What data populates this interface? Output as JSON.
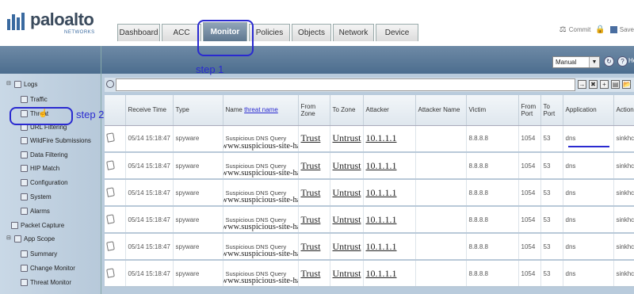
{
  "header": {
    "logo_text": "paloalto",
    "logo_sub": "NETWORKS",
    "tabs": [
      "Dashboard",
      "ACC",
      "Monitor",
      "Policies",
      "Objects",
      "Network",
      "Device"
    ],
    "commit_label": "Commit",
    "save_label": "Save"
  },
  "annotations": {
    "step1": "step 1",
    "step2": "step 2",
    "threat_name_note": "threat name"
  },
  "sidebar": {
    "items": [
      {
        "label": "Logs",
        "level": 0,
        "toggle": "⊟"
      },
      {
        "label": "Traffic",
        "level": 1
      },
      {
        "label": "Threat",
        "level": 1
      },
      {
        "label": "URL Filtering",
        "level": 1
      },
      {
        "label": "WildFire Submissions",
        "level": 1
      },
      {
        "label": "Data Filtering",
        "level": 1
      },
      {
        "label": "HIP Match",
        "level": 1
      },
      {
        "label": "Configuration",
        "level": 1
      },
      {
        "label": "System",
        "level": 1
      },
      {
        "label": "Alarms",
        "level": 1
      },
      {
        "label": "Packet Capture",
        "level": 0
      },
      {
        "label": "App Scope",
        "level": 0,
        "toggle": "⊟"
      },
      {
        "label": "Summary",
        "level": 1
      },
      {
        "label": "Change Monitor",
        "level": 1
      },
      {
        "label": "Threat Monitor",
        "level": 1
      }
    ]
  },
  "toolbar": {
    "refresh_value": "Manual",
    "help_label": "He"
  },
  "table": {
    "columns": [
      "",
      "Receive Time",
      "Type",
      "Name",
      "From Zone",
      "To Zone",
      "Attacker",
      "Attacker Name",
      "Victim",
      "From Port",
      "To Port",
      "Application",
      "Action"
    ],
    "rows": [
      {
        "time": "05/14 15:18:47",
        "type": "spyware",
        "name": "Suspicious DNS Query",
        "domain": "www.suspicious-site-hacker.com",
        "from_zone": "Trust",
        "to_zone": "Untrust",
        "attacker": "10.1.1.1",
        "attacker_name": "",
        "victim": "8.8.8.8",
        "from_port": "1054",
        "to_port": "53",
        "application": "dns",
        "action": "sinkhc"
      },
      {
        "time": "05/14 15:18:47",
        "type": "spyware",
        "name": "Suspicious DNS Query",
        "domain": "www.suspicious-site-hacker.com",
        "from_zone": "Trust",
        "to_zone": "Untrust",
        "attacker": "10.1.1.1",
        "attacker_name": "",
        "victim": "8.8.8.8",
        "from_port": "1054",
        "to_port": "53",
        "application": "dns",
        "action": "sinkhc"
      },
      {
        "time": "05/14 15:18:47",
        "type": "spyware",
        "name": "Suspicious DNS Query",
        "domain": "www.suspicious-site-hacker.com",
        "from_zone": "Trust",
        "to_zone": "Untrust",
        "attacker": "10.1.1.1",
        "attacker_name": "",
        "victim": "8.8.8.8",
        "from_port": "1054",
        "to_port": "53",
        "application": "dns",
        "action": "sinkhc"
      },
      {
        "time": "05/14 15:18:47",
        "type": "spyware",
        "name": "Suspicious DNS Query",
        "domain": "www.suspicious-site-hacker.com",
        "from_zone": "Trust",
        "to_zone": "Untrust",
        "attacker": "10.1.1.1",
        "attacker_name": "",
        "victim": "8.8.8.8",
        "from_port": "1054",
        "to_port": "53",
        "application": "dns",
        "action": "sinkhc"
      },
      {
        "time": "05/14 15:18:47",
        "type": "spyware",
        "name": "Suspicious DNS Query",
        "domain": "www.suspicious-site-hacker.com",
        "from_zone": "Trust",
        "to_zone": "Untrust",
        "attacker": "10.1.1.1",
        "attacker_name": "",
        "victim": "8.8.8.8",
        "from_port": "1054",
        "to_port": "53",
        "application": "dns",
        "action": "sinkhc"
      },
      {
        "time": "05/14 15:18:47",
        "type": "spyware",
        "name": "Suspicious DNS Query",
        "domain": "www.suspicious-site-hacker.com",
        "from_zone": "Trust",
        "to_zone": "Untrust",
        "attacker": "10.1.1.1",
        "attacker_name": "",
        "victim": "8.8.8.8",
        "from_port": "1054",
        "to_port": "53",
        "application": "dns",
        "action": "sinkhc"
      }
    ]
  },
  "colors": {
    "annotation": "#2a2ad0",
    "header_bar": "#4c6d8e",
    "sidebar_bg": "#c9d8e6"
  }
}
